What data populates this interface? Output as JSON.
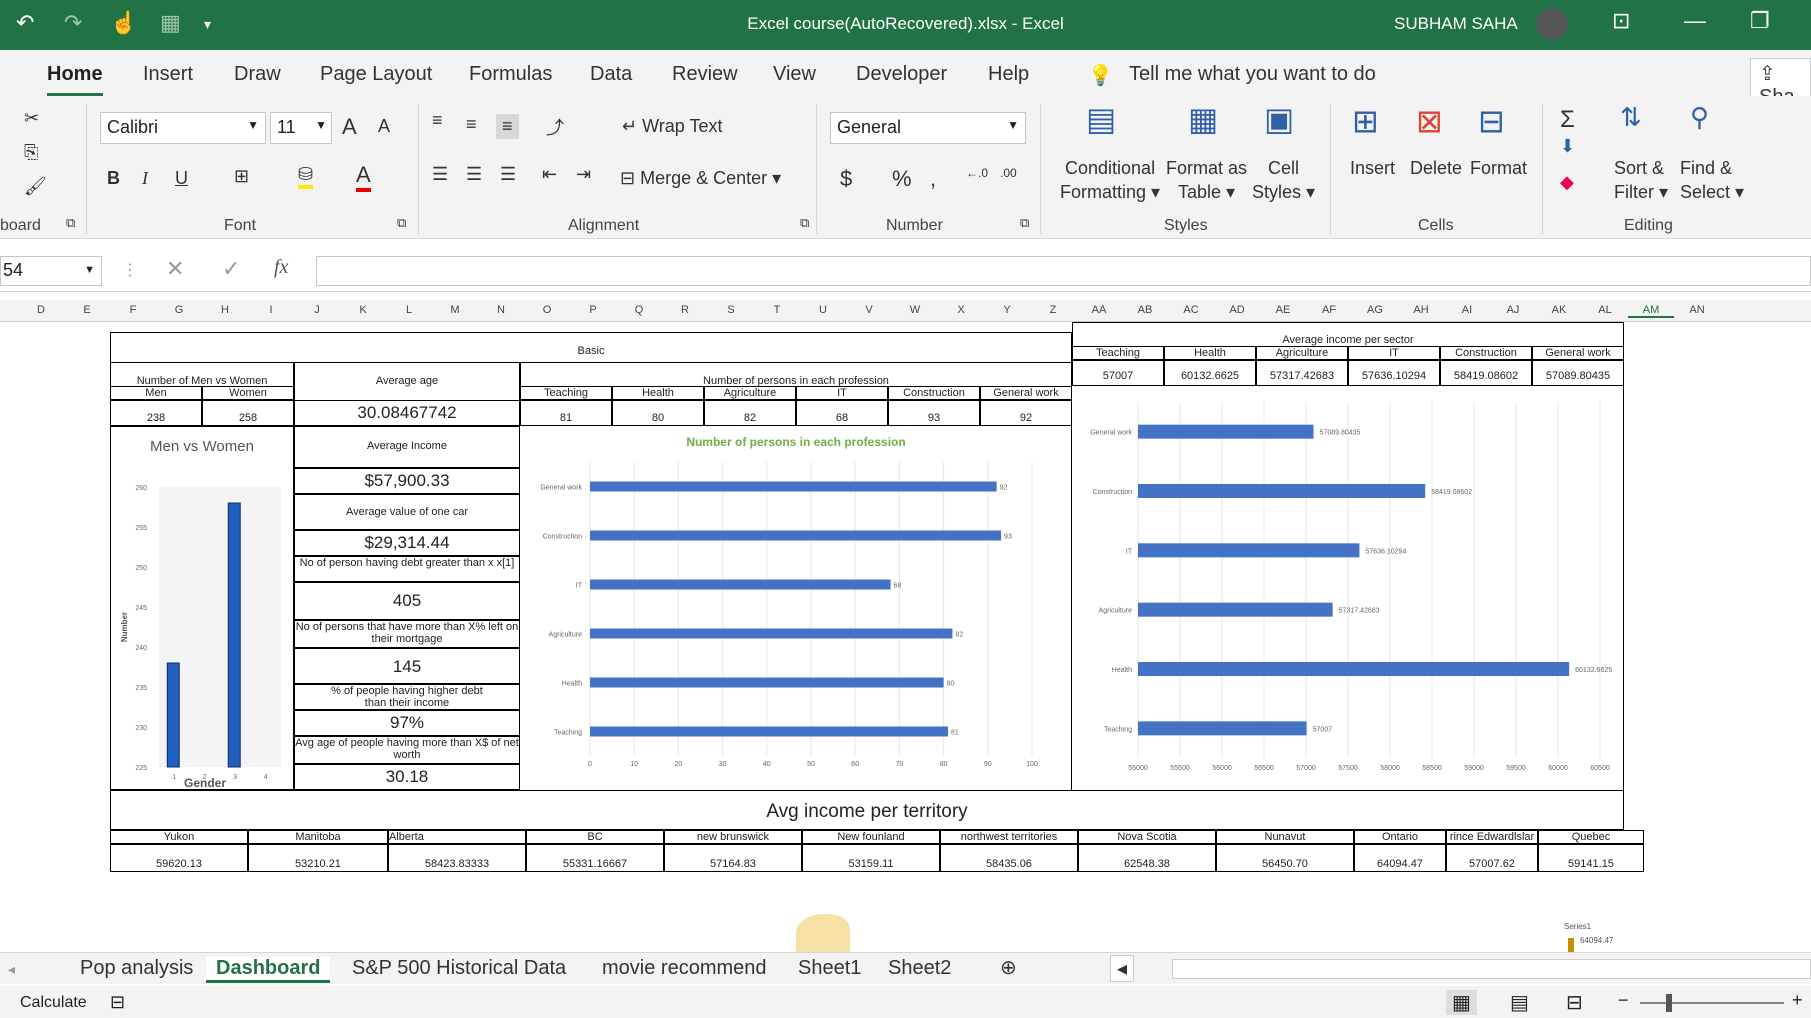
{
  "title": "Excel course(AutoRecovered).xlsx  -  Excel",
  "user": "SUBHAM SAHA",
  "ribbon_tabs": [
    "Home",
    "Insert",
    "Draw",
    "Page Layout",
    "Formulas",
    "Data",
    "Review",
    "View",
    "Developer",
    "Help"
  ],
  "tell_me": "Tell me what you want to do",
  "share": "Sha",
  "font": {
    "name": "Calibri",
    "size": "11"
  },
  "labels": {
    "clipboard": "board",
    "font": "Font",
    "alignment": "Alignment",
    "number": "Number",
    "styles": "Styles",
    "cells": "Cells",
    "editing": "Editing",
    "wrap_text": "Wrap Text",
    "merge_center": "Merge & Center",
    "number_format": "General",
    "conditional": "Conditional",
    "formatting": "Formatting",
    "format_as": "Format as",
    "table": "Table",
    "cell": "Cell",
    "styles_btn": "Styles",
    "insert": "Insert",
    "delete": "Delete",
    "format": "Format",
    "sort": "Sort &",
    "filter": "Filter",
    "find": "Find &",
    "select": "Select"
  },
  "name_box": "54",
  "columns": [
    "D",
    "E",
    "F",
    "G",
    "H",
    "I",
    "J",
    "K",
    "L",
    "M",
    "N",
    "O",
    "P",
    "Q",
    "R",
    "S",
    "T",
    "U",
    "V",
    "W",
    "X",
    "Y",
    "Z",
    "AA",
    "AB",
    "AC",
    "AD",
    "AE",
    "AF",
    "AG",
    "AH",
    "AI",
    "AJ",
    "AK",
    "AL",
    "AM",
    "AN"
  ],
  "dashboard": {
    "basic": "Basic",
    "men_women_header": "Number of Men vs Women",
    "men": "Men",
    "women": "Women",
    "men_val": "238",
    "women_val": "258",
    "avg_age_label": "Average age",
    "avg_age": "30.08467742",
    "avg_income_label": "Average Income",
    "avg_income": "$57,900.33",
    "avg_car_label": "Average value of one car",
    "avg_car": "$29,314.44",
    "debt_label": "No of person having debt greater than x x[1]",
    "debt_val": "405",
    "mortgage_label": "No of persons that have more than X% left on their mortgage",
    "mortgage_val": "145",
    "higher_debt_label": "% of people having higher debt than their income",
    "higher_debt_val": "97%",
    "avg_age_networth_label": "Avg age of people having more than X$ of net worth",
    "avg_age_networth": "30.18",
    "profession_header": "Number of persons in each profession",
    "professions": [
      "Teaching",
      "Health",
      "Agriculture",
      "IT",
      "Construction",
      "General work"
    ],
    "profession_counts": [
      "81",
      "80",
      "82",
      "68",
      "93",
      "92"
    ],
    "sector_header": "Average income per sector",
    "sector_values": [
      "57007",
      "60132.6625",
      "57317.42683",
      "57636.10294",
      "58419.08602",
      "57089.80435"
    ],
    "territory_header": "Avg income per territory",
    "territories": [
      "Yukon",
      "Manitoba",
      "Alberta",
      "BC",
      "new brunswick",
      "New founland",
      "northwest territories",
      "Nova Scotia",
      "Nunavut",
      "Ontario",
      "rince Edwardlslar",
      "Quebec"
    ],
    "territory_values": [
      "59620.13",
      "53210.21",
      "58423.83333",
      "55331.16667",
      "57164.83",
      "53159.11",
      "58435.06",
      "62548.38",
      "56450.70",
      "64094.47",
      "57007.62",
      "59141.15"
    ],
    "bottom_series": "Series1",
    "bottom_value": "64094.47"
  },
  "chart_data": [
    {
      "type": "bar",
      "title": "Men vs Women",
      "categories": [
        "1",
        "2",
        "3",
        "4"
      ],
      "values": [
        238,
        null,
        258,
        null
      ],
      "xlabel": "Gender",
      "ylabel": "Number",
      "ylim": [
        225,
        260
      ],
      "yticks": [
        "225",
        "230",
        "235",
        "240",
        "245",
        "250",
        "255",
        "260"
      ]
    },
    {
      "type": "bar",
      "orientation": "horizontal",
      "title": "Number of persons in each profession",
      "categories": [
        "Teaching",
        "Health",
        "Agriculture",
        "IT",
        "Construction",
        "General work"
      ],
      "values": [
        81,
        80,
        82,
        68,
        93,
        92
      ],
      "xlim": [
        0,
        100
      ],
      "xticks": [
        "0",
        "10",
        "20",
        "30",
        "40",
        "50",
        "60",
        "70",
        "80",
        "90",
        "100"
      ]
    },
    {
      "type": "bar",
      "orientation": "horizontal",
      "title": "",
      "categories": [
        "Teaching",
        "Health",
        "Agriculture",
        "IT",
        "Construction",
        "General work"
      ],
      "values": [
        57007,
        60132.6625,
        57317.42683,
        57636.10294,
        58419.08602,
        57089.80435
      ],
      "labels": [
        "57007",
        "60132.6625",
        "57317.42683",
        "57636.10294",
        "58419.08602",
        "57089.80435"
      ],
      "xlim": [
        55000,
        60500
      ],
      "xticks": [
        "55000",
        "55500",
        "56000",
        "56500",
        "57000",
        "57500",
        "58000",
        "58500",
        "59000",
        "59500",
        "60000",
        "60500"
      ]
    }
  ],
  "sheet_tabs": [
    "Pop analysis",
    "Dashboard",
    "S&P 500 Historical Data",
    "movie recommend",
    "Sheet1",
    "Sheet2"
  ],
  "status": "Calculate",
  "colors": {
    "excel_green": "#217346",
    "bar_blue": "#4472c4",
    "bar_dark": "#1f5fbf",
    "title_green": "#70ad47"
  }
}
